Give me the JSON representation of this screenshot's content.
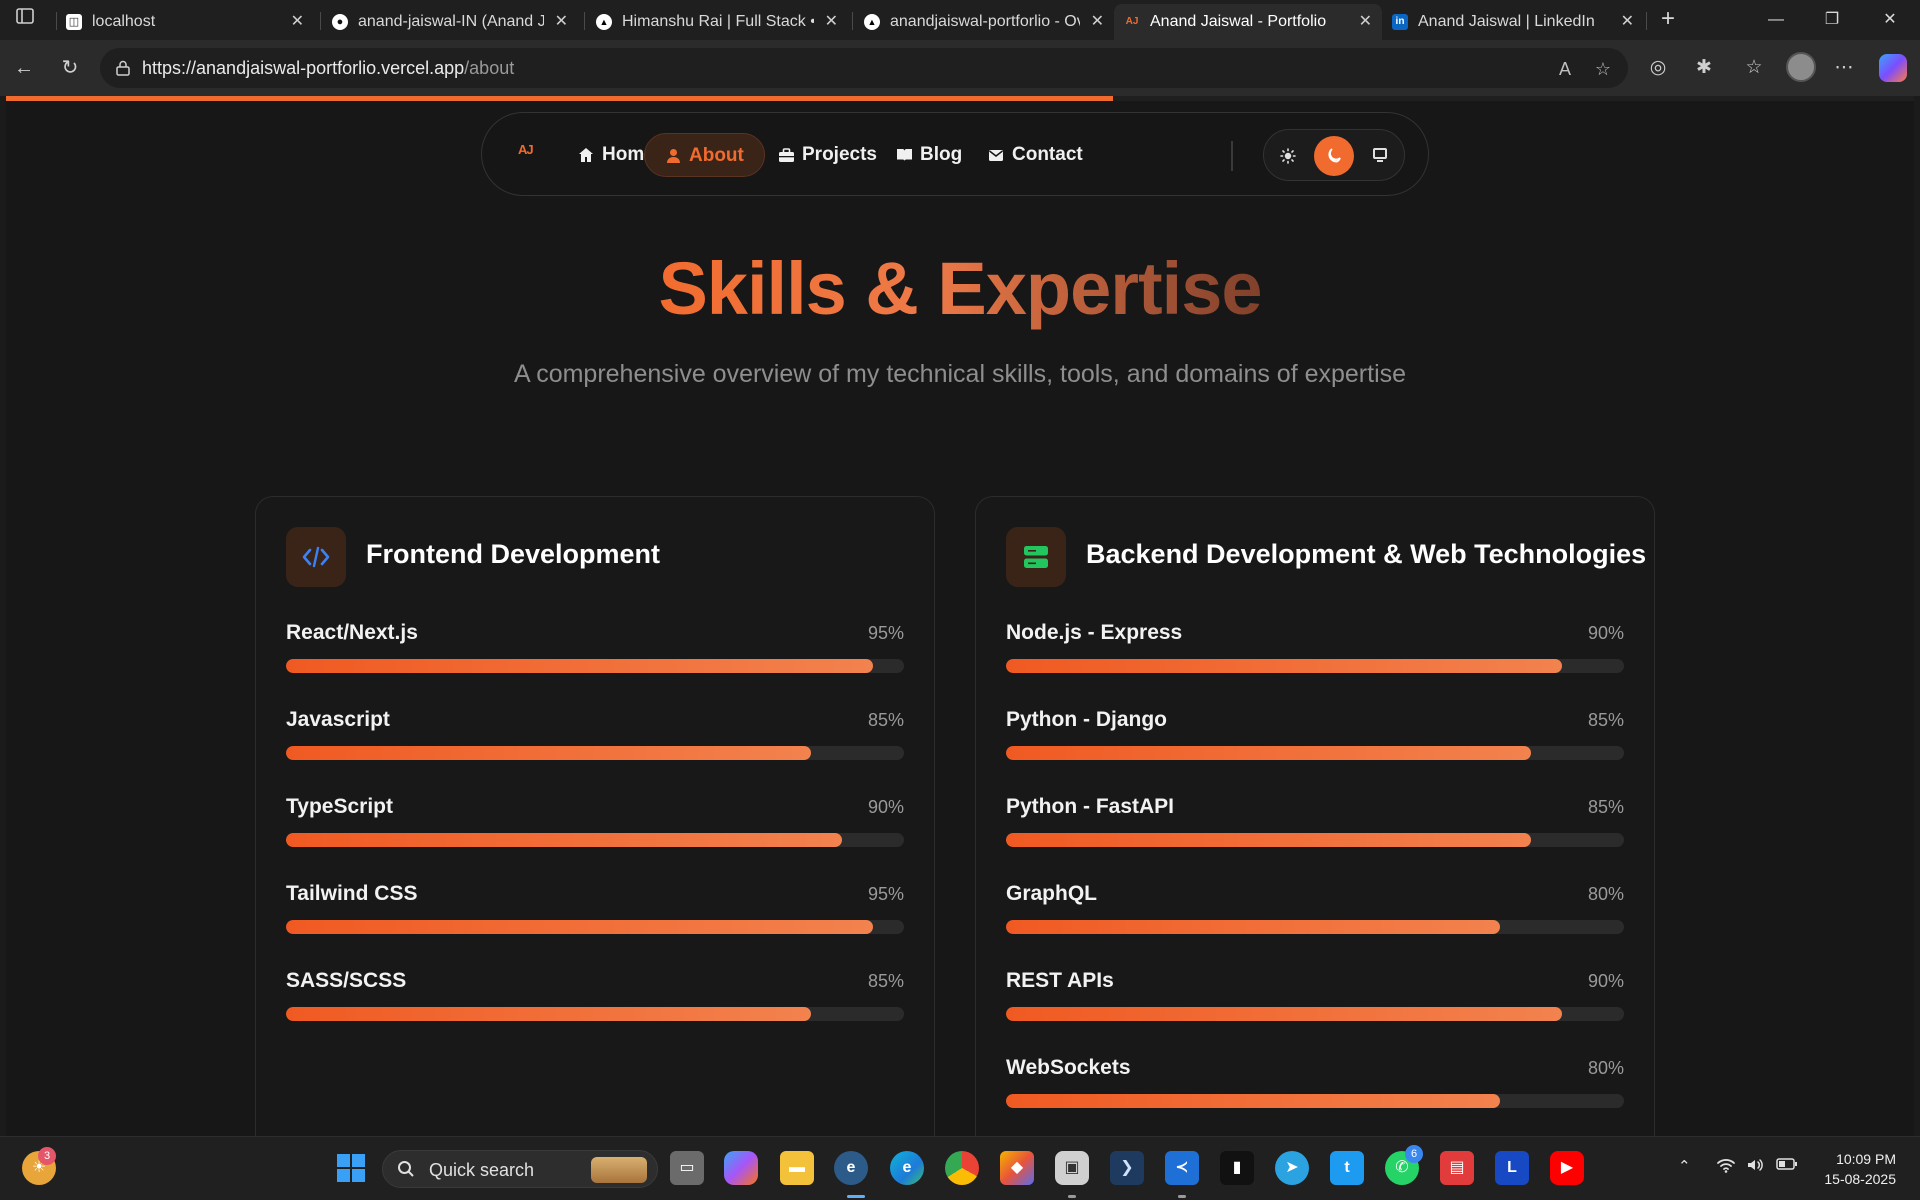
{
  "browser": {
    "tabs": [
      {
        "title": "localhost",
        "favicon": "page-icon"
      },
      {
        "title": "anand-jaiswal-IN (Anand Jaiswal)",
        "favicon": "github-icon"
      },
      {
        "title": "Himanshu Rai | Full Stack • D",
        "favicon": "vercel-icon"
      },
      {
        "title": "anandjaiswal-portforlio - Ov",
        "favicon": "vercel-icon"
      },
      {
        "title": "Anand Jaiswal - Portfolio",
        "favicon": "aj-logo-icon",
        "active": true
      },
      {
        "title": "Anand Jaiswal | LinkedIn",
        "favicon": "linkedin-icon"
      }
    ],
    "url": {
      "host": "https://anandjaiswal-portforlio.vercel.app",
      "path": "/about"
    }
  },
  "page": {
    "scroll_progress_percent": 58,
    "nav": {
      "logo": "AJ",
      "links": [
        {
          "label": "Home",
          "icon": "home-icon"
        },
        {
          "label": "About",
          "icon": "user-icon",
          "active": true
        },
        {
          "label": "Projects",
          "icon": "briefcase-icon"
        },
        {
          "label": "Blog",
          "icon": "book-icon"
        },
        {
          "label": "Contact",
          "icon": "envelope-icon"
        }
      ],
      "theme_options": [
        "light",
        "dark",
        "system"
      ],
      "theme_selected": "dark"
    },
    "hero": {
      "title": "Skills & Expertise",
      "subtitle": "A comprehensive overview of my technical skills, tools, and domains of expertise"
    },
    "cards": [
      {
        "title": "Frontend Development",
        "icon": "code-icon",
        "skills": [
          {
            "name": "React/Next.js",
            "pct_label": "95%",
            "value": 95
          },
          {
            "name": "Javascript",
            "pct_label": "85%",
            "value": 85
          },
          {
            "name": "TypeScript",
            "pct_label": "90%",
            "value": 90
          },
          {
            "name": "Tailwind CSS",
            "pct_label": "95%",
            "value": 95
          },
          {
            "name": "SASS/SCSS",
            "pct_label": "85%",
            "value": 85
          }
        ]
      },
      {
        "title": "Backend Development & Web Technologies",
        "icon": "server-icon",
        "skills": [
          {
            "name": "Node.js - Express",
            "pct_label": "90%",
            "value": 90
          },
          {
            "name": "Python - Django",
            "pct_label": "85%",
            "value": 85
          },
          {
            "name": "Python - FastAPI",
            "pct_label": "85%",
            "value": 85
          },
          {
            "name": "GraphQL",
            "pct_label": "80%",
            "value": 80
          },
          {
            "name": "REST APIs",
            "pct_label": "90%",
            "value": 90
          },
          {
            "name": "WebSockets",
            "pct_label": "80%",
            "value": 80
          }
        ]
      }
    ]
  },
  "taskbar": {
    "search_placeholder": "Quick search",
    "weather_badge": "3",
    "whatsapp_badge": "6",
    "time": "10:09 PM",
    "date": "15-08-2025"
  },
  "colors": {
    "accent": "#f26b2e",
    "page_bg": "#171717"
  }
}
